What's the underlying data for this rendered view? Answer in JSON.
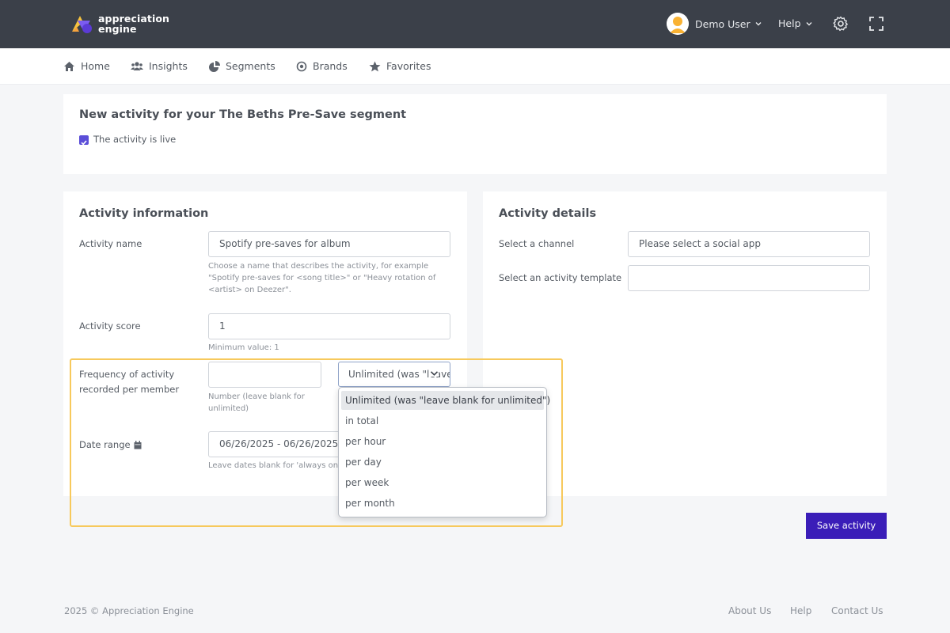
{
  "header": {
    "logo_line1": "appreciation",
    "logo_line2": "engine",
    "user_name": "Demo User",
    "help_label": "Help",
    "icons": [
      "chevron-down-icon",
      "gear-icon",
      "fullscreen-icon"
    ]
  },
  "nav": {
    "items": [
      {
        "label": "Home",
        "icon": "home-icon"
      },
      {
        "label": "Insights",
        "icon": "users-icon"
      },
      {
        "label": "Segments",
        "icon": "pie-chart-icon"
      },
      {
        "label": "Brands",
        "icon": "target-icon"
      },
      {
        "label": "Favorites",
        "icon": "star-icon"
      }
    ]
  },
  "segment_card": {
    "title": "New activity for your The Beths Pre-Save segment",
    "live_label": "The activity is live",
    "live_checked": true
  },
  "activity_info": {
    "title": "Activity information",
    "name_label": "Activity name",
    "name_value": "Spotify pre-saves for album",
    "name_hint": "Choose a name that describes the activity, for example \"Spotify pre-saves for <song title>\" or \"Heavy rotation of <artist> on Deezer\".",
    "score_label": "Activity score",
    "score_value": "1",
    "score_hint": "Minimum value: 1",
    "frequency_label": "Frequency of activity recorded per member",
    "frequency_value": "",
    "frequency_hint": "Number (leave blank for unlimited)",
    "frequency_unit_selected": "Unlimited (was \"leave blank for unlimited\")",
    "date_label": "Date range",
    "date_value": "06/26/2025 - 06/26/2025",
    "date_hint": "Leave dates blank for 'always on'"
  },
  "frequency_options": [
    "Unlimited (was \"leave blank for unlimited\")",
    "in total",
    "per hour",
    "per day",
    "per week",
    "per month"
  ],
  "activity_details": {
    "title": "Activity details",
    "channel_label": "Select a channel",
    "channel_placeholder": "Please select a social app",
    "template_label": "Select an activity template",
    "template_value": ""
  },
  "actions": {
    "save_label": "Save activity"
  },
  "footer": {
    "copyright": "2025 © Appreciation Engine",
    "links": [
      "About Us",
      "Help",
      "Contact Us"
    ]
  },
  "colors": {
    "topbar": "#3b4049",
    "primary_button": "#3a1db8",
    "checkbox": "#5b4ed8",
    "highlight": "#f7c95c"
  }
}
